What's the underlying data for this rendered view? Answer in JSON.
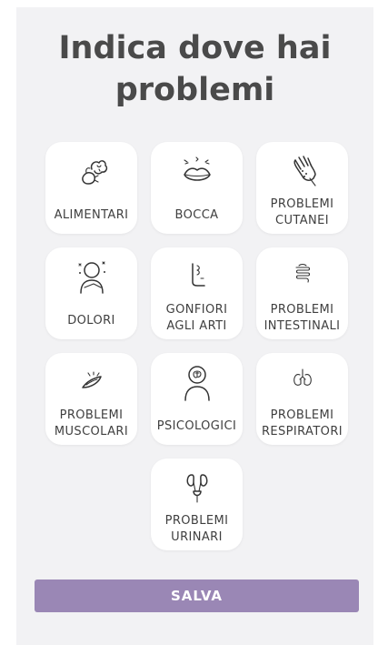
{
  "title": "Indica dove hai problemi",
  "categories": [
    {
      "label": "ALIMENTARI",
      "icon": "vegetables-icon"
    },
    {
      "label": "BOCCA",
      "icon": "mouth-icon"
    },
    {
      "label": "PROBLEMI\nCUTANEI",
      "icon": "skin-hand-icon"
    },
    {
      "label": "DOLORI",
      "icon": "pain-person-icon"
    },
    {
      "label": "GONFIORI\nAGLI ARTI",
      "icon": "swollen-leg-icon"
    },
    {
      "label": "PROBLEMI\nINTESTINALI",
      "icon": "intestine-icon"
    },
    {
      "label": "PROBLEMI\nMUSCOLARI",
      "icon": "muscle-icon"
    },
    {
      "label": "PSICOLOGICI",
      "icon": "psychology-head-icon"
    },
    {
      "label": "PROBLEMI\nRESPIRATORI",
      "icon": "lungs-icon"
    },
    {
      "label": "PROBLEMI\nURINARI",
      "icon": "urinary-icon"
    }
  ],
  "save_button": {
    "label": "SALVA"
  },
  "colors": {
    "background": "#f2f2f4",
    "tile": "#ffffff",
    "title_text": "#4a4a4a",
    "button": "#9a87b5",
    "button_text": "#ffffff"
  }
}
